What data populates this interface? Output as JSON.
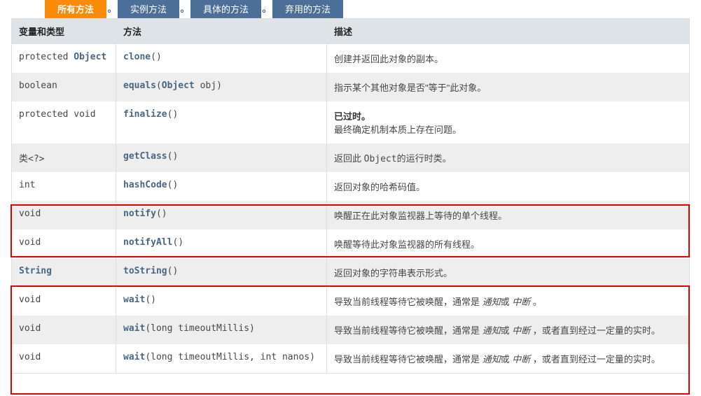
{
  "tabs": {
    "all": "所有方法",
    "instance": "实例方法",
    "concrete": "具体的方法",
    "deprecated": "弃用的方法",
    "sep": "。"
  },
  "headers": {
    "type": "变量和类型",
    "method": "方法",
    "desc": "描述"
  },
  "rows": [
    {
      "type_pre": "protected ",
      "type_link": "Object",
      "method": "clone",
      "params": "()",
      "desc": "创建并返回此对象的副本。"
    },
    {
      "type_pre": "boolean",
      "type_link": "",
      "method": "equals",
      "params_pre": "(",
      "params_link": "Object",
      "params_post": " obj)",
      "desc": "指示某个其他对象是否\"等于\"此对象。"
    },
    {
      "type_pre": "protected void",
      "type_link": "",
      "method": "finalize",
      "params": "()",
      "desc_deprecated_label": "已过时。",
      "desc_deprecated_body": "最终确定机制本质上存在问题。"
    },
    {
      "type_pre": "类<?>",
      "type_link": "",
      "method": "getClass",
      "params": "()",
      "desc_pre": "返回此 ",
      "desc_code": "Object",
      "desc_post": "的运行时类。"
    },
    {
      "type_pre": "int",
      "type_link": "",
      "method": "hashCode",
      "params": "()",
      "desc": "返回对象的哈希码值。"
    },
    {
      "type_pre": "void",
      "type_link": "",
      "method": "notify",
      "params": "()",
      "desc": "唤醒正在此对象监视器上等待的单个线程。"
    },
    {
      "type_pre": "void",
      "type_link": "",
      "method": "notifyAll",
      "params": "()",
      "desc": "唤醒等待此对象监视器的所有线程。"
    },
    {
      "type_pre": "",
      "type_link": "String",
      "method": "toString",
      "params": "()",
      "desc": "返回对象的字符串表示形式。"
    },
    {
      "type_pre": "void",
      "type_link": "",
      "method": "wait",
      "params": "()",
      "desc_pre": "导致当前线程等待它被唤醒，通常是 ",
      "desc_i1": "通知",
      "desc_mid": "或 ",
      "desc_i2": "中断",
      "desc_post": " 。"
    },
    {
      "type_pre": "void",
      "type_link": "",
      "method": "wait",
      "params": "(long timeoutMillis)",
      "desc_pre": "导致当前线程等待它被唤醒，通常是 ",
      "desc_i1": "通知",
      "desc_mid": "或 ",
      "desc_i2": "中断",
      "desc_post": " ，或者直到经过一定量的实时。"
    },
    {
      "type_pre": "void",
      "type_link": "",
      "method": "wait",
      "params": "(long timeoutMillis, int nanos)",
      "desc_pre": "导致当前线程等待它被唤醒，通常是 ",
      "desc_i1": "通知",
      "desc_mid": "或 ",
      "desc_i2": "中断",
      "desc_post": " ，或者直到经过一定量的实时。"
    }
  ]
}
